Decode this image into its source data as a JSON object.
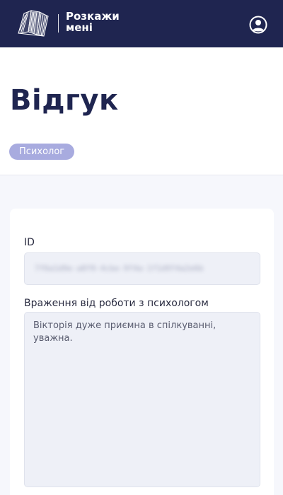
{
  "header": {
    "brand_line1": "Розкажи",
    "brand_line2": "мені",
    "logo_icon": "folded-paper-logo-icon",
    "profile_icon": "user-circle-icon"
  },
  "page": {
    "title": "Відгук",
    "badge": "Психолог"
  },
  "form": {
    "id_label": "ID",
    "id_value": "7f6a1d9e-a8f0-4cbe-9f4a-1f1d9f4a2e6b",
    "impression_label": "Враження від роботи з психологом",
    "impression_value": "Вікторія дуже приємна в спілкуванні, уважна."
  },
  "colors": {
    "header_bg": "#1f2550",
    "title": "#1f2550",
    "badge_bg": "#a8abdf",
    "content_bg": "#f6f7fc",
    "field_bg": "#eef0f7"
  }
}
